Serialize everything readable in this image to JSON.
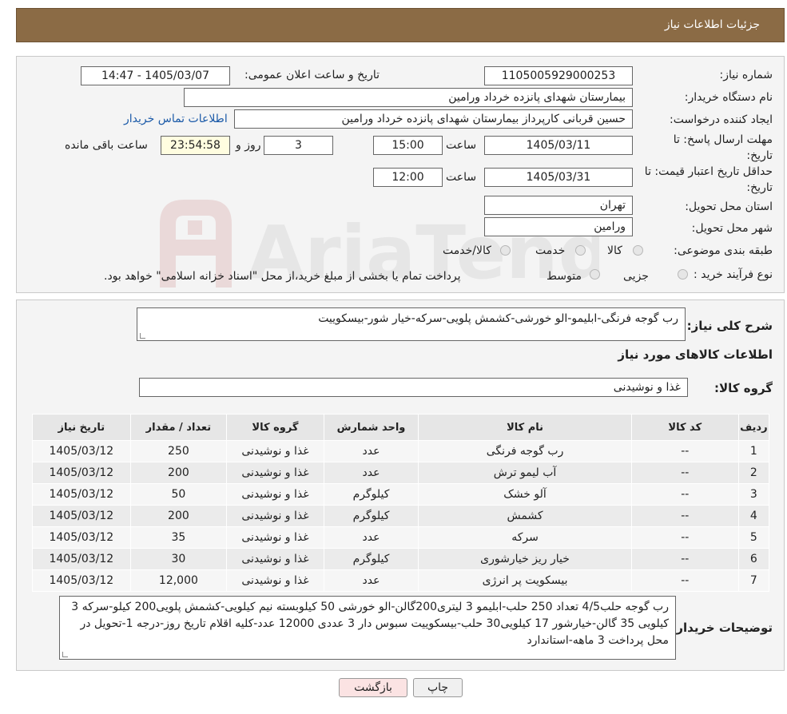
{
  "header": {
    "title": "جزئیات اطلاعات نیاز"
  },
  "form": {
    "need_number_label": "شماره نیاز:",
    "need_number": "1105005929000253",
    "announce_label": "تاریخ و ساعت اعلان عمومی:",
    "announce_value": "1405/03/07 - 14:47",
    "buyer_org_label": "نام دستگاه خریدار:",
    "buyer_org": "بیمارستان شهدای پانزده خرداد ورامین",
    "creator_label": "ایجاد کننده درخواست:",
    "creator": "حسین قربانی کارپرداز بیمارستان شهدای پانزده خرداد ورامین",
    "contact_link": "اطلاعات تماس خریدار",
    "deadline_label": "مهلت ارسال پاسخ: تا تاریخ:",
    "deadline_date": "1405/03/11",
    "time_label": "ساعت",
    "deadline_time": "15:00",
    "days_value": "3",
    "days_label": "روز و",
    "remaining_time": "23:54:58",
    "remaining_label": "ساعت باقی مانده",
    "validity_label": "حداقل تاریخ اعتبار قیمت: تا تاریخ:",
    "validity_date": "1405/03/31",
    "validity_time": "12:00",
    "province_label": "استان محل تحویل:",
    "province": "تهران",
    "city_label": "شهر محل تحویل:",
    "city": "ورامین",
    "category_label": "طبقه بندی موضوعی:",
    "category_options": [
      "کالا",
      "خدمت",
      "کالا/خدمت"
    ],
    "process_label": "نوع فرآیند خرید :",
    "process_options": [
      "جزیی",
      "متوسط"
    ],
    "process_note": "پرداخت تمام یا بخشی از مبلغ خرید،از محل \"اسناد خزانه اسلامی\" خواهد بود."
  },
  "summary": {
    "description_label": "شرح کلی نیاز:",
    "description": "رب گوجه فرنگی-ابلیمو-الو خورشی-کشمش پلویی-سرکه-خیار شور-بیسکوییت",
    "goods_info_title": "اطلاعات کالاهای مورد نیاز",
    "goods_group_label": "گروه کالا:",
    "goods_group": "غذا و نوشیدنی"
  },
  "table": {
    "headers": [
      "ردیف",
      "کد کالا",
      "نام کالا",
      "واحد شمارش",
      "گروه کالا",
      "تعداد / مقدار",
      "تاریخ نیاز"
    ],
    "rows": [
      [
        "1",
        "--",
        "رب گوجه فرنگی",
        "عدد",
        "غذا و نوشیدنی",
        "250",
        "1405/03/12"
      ],
      [
        "2",
        "--",
        "آب لیمو ترش",
        "عدد",
        "غذا و نوشیدنی",
        "200",
        "1405/03/12"
      ],
      [
        "3",
        "--",
        "آلو خشک",
        "کیلوگرم",
        "غذا و نوشیدنی",
        "50",
        "1405/03/12"
      ],
      [
        "4",
        "--",
        "کشمش",
        "کیلوگرم",
        "غذا و نوشیدنی",
        "200",
        "1405/03/12"
      ],
      [
        "5",
        "--",
        "سرکه",
        "عدد",
        "غذا و نوشیدنی",
        "35",
        "1405/03/12"
      ],
      [
        "6",
        "--",
        "خیار ریز خیارشوری",
        "کیلوگرم",
        "غذا و نوشیدنی",
        "30",
        "1405/03/12"
      ],
      [
        "7",
        "--",
        "بیسکویت پر انرژی",
        "عدد",
        "غذا و نوشیدنی",
        "12,000",
        "1405/03/12"
      ]
    ]
  },
  "buyer_notes": {
    "label": "توضیحات خریدار:",
    "text": "رب گوجه حلب4/5 تعداد 250 حلب-ابلیمو 3 لیتری200گالن-الو خورشی 50 کیلوبسته نیم کیلویی-کشمش پلویی200 کیلو-سرکه 3 کیلویی 35 گالن-خیارشور 17 کیلویی30 حلب-بیسکوییت سبوس دار 3 عددی 12000 عدد-کلیه اقلام تاریخ روز-درجه 1-تحویل در محل پرداخت 3 ماهه-استاندارد"
  },
  "buttons": {
    "print": "چاپ",
    "back": "بازگشت"
  },
  "watermark": "AriaTender.neT",
  "colors": {
    "header_bg": "#8b6b45",
    "link": "#1b5aa8",
    "back_button_bg": "#fbe3e3"
  }
}
